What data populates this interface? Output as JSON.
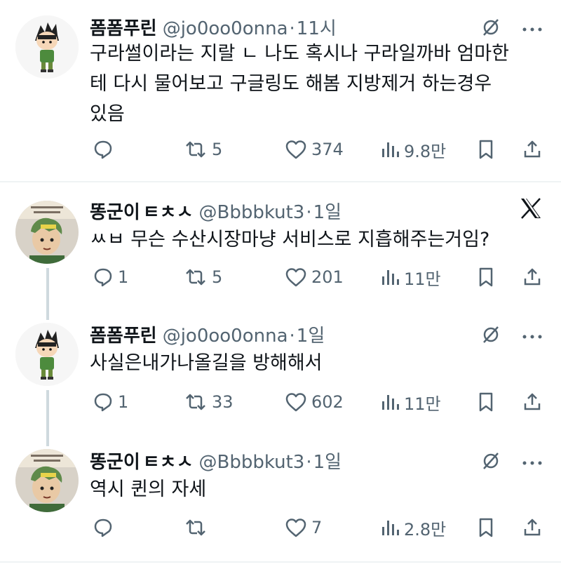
{
  "tweets": [
    {
      "name": "폼폼푸린",
      "badge": "",
      "handle": "@jo0oo0onna",
      "time": "11시",
      "text_lines": [
        "구라썰이라는 지랄 ㄴ 나도 혹시나 구라일까바 엄마한",
        "테 다시 물어보고 구글링도 해봄 지방제거 하는경우",
        "있음"
      ],
      "reply": "",
      "retweet": "5",
      "like": "374",
      "views": "9.8만",
      "corner_icon": "grok-icon"
    },
    {
      "name": "똥군이",
      "badge": "ㅌㅊㅅ",
      "handle": "@Bbbbkut3",
      "time": "1일",
      "text_lines": [
        "ㅆㅂ 무슨 수산시장마냥 서비스로 지흡해주는거임?"
      ],
      "reply": "1",
      "retweet": "5",
      "like": "201",
      "views": "11만",
      "corner_icon": "x-logo-icon"
    },
    {
      "name": "폼폼푸린",
      "badge": "",
      "handle": "@jo0oo0onna",
      "time": "1일",
      "text_lines": [
        "사실은내가나올길을 방해해서"
      ],
      "reply": "1",
      "retweet": "33",
      "like": "602",
      "views": "11만",
      "corner_icon": "grok-icon"
    },
    {
      "name": "똥군이",
      "badge": "ㅌㅊㅅ",
      "handle": "@Bbbbkut3",
      "time": "1일",
      "text_lines": [
        "역시 퀸의 자세"
      ],
      "reply": "",
      "retweet": "",
      "like": "7",
      "views": "2.8만",
      "corner_icon": "grok-icon"
    }
  ],
  "separator": "·",
  "colors": {
    "text": "#0f1419",
    "muted": "#536471",
    "line": "#eff3f4",
    "thread": "#cfd9de"
  }
}
